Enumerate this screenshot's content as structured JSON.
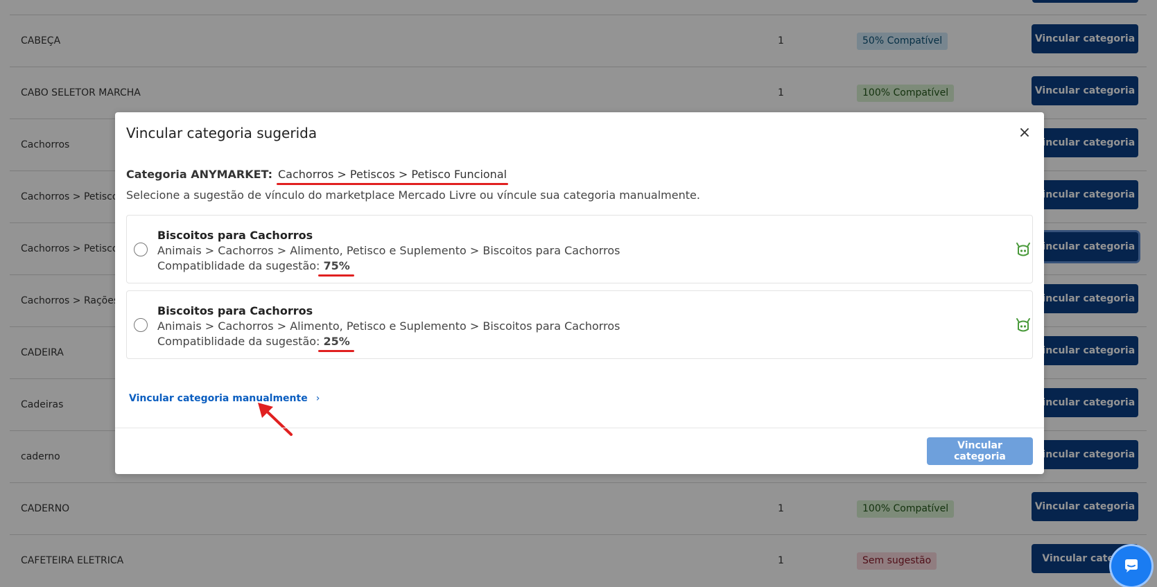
{
  "table": {
    "rows": [
      {
        "name": "CABEÇA",
        "count": "1",
        "badge": "50% Compatível",
        "badge_kind": "partial",
        "button": "Vincular categoria"
      },
      {
        "name": "CABO SELETOR MARCHA",
        "count": "1",
        "badge": "100% Compatível",
        "badge_kind": "full",
        "button": "Vincular categoria"
      },
      {
        "name": "Cachorros",
        "count": "",
        "badge": "",
        "badge_kind": "",
        "button": "Vincular categoria"
      },
      {
        "name": "Cachorros > Petiscos",
        "count": "",
        "badge": "",
        "badge_kind": "",
        "button": "Vincular categoria"
      },
      {
        "name": "Cachorros > Petiscos",
        "count": "",
        "badge": "",
        "badge_kind": "",
        "button": "Vincular categoria"
      },
      {
        "name": "Cachorros > Rações >",
        "count": "",
        "badge": "",
        "badge_kind": "",
        "button": "Vincular categoria"
      },
      {
        "name": "CADEIRA",
        "count": "",
        "badge": "",
        "badge_kind": "",
        "button": "Vincular categoria"
      },
      {
        "name": "Cadeiras",
        "count": "",
        "badge": "",
        "badge_kind": "",
        "button": "Vincular categoria"
      },
      {
        "name": "caderno",
        "count": "",
        "badge": "",
        "badge_kind": "",
        "button": "Vincular categoria"
      },
      {
        "name": "CADERNO",
        "count": "1",
        "badge": "100% Compatível",
        "badge_kind": "full",
        "button": "Vincular categoria"
      },
      {
        "name": "CAFETEIRA ELETRICA",
        "count": "1",
        "badge": "Sem sugestão",
        "badge_kind": "none",
        "button": "Vincular catego"
      }
    ]
  },
  "modal": {
    "title": "Vincular categoria sugerida",
    "close_label": "×",
    "category_label": "Categoria ANYMARKET:",
    "category_path": "Cachorros > Petiscos > Petisco Funcional",
    "instructions": "Selecione a sugestão de vínculo do marketplace Mercado Livre ou víncule sua categoria manualmente.",
    "suggestions": [
      {
        "title": "Biscoitos para Cachorros",
        "path": "Animais > Cachorros > Alimento, Petisco e Suplemento > Biscoitos para Cachorros",
        "compat_label": "Compatiblidade da sugestão:",
        "compat_value": "75%",
        "icon": "robot-icon"
      },
      {
        "title": "Biscoitos para Cachorros",
        "path": "Animais > Cachorros > Alimento, Petisco e Suplemento > Biscoitos para Cachorros",
        "compat_label": "Compatiblidade da sugestão:",
        "compat_value": "25%",
        "icon": "robot-icon"
      }
    ],
    "manual_link": "Vincular categoria manualmente",
    "manual_chevron": "›",
    "submit_label": "Vincular categoria"
  },
  "colors": {
    "primary_button": "#0b3f86",
    "disabled_button": "#6ea0dc",
    "link": "#0b5ec0",
    "annotation": "#e02020",
    "robot": "#4a9a3b",
    "chat_button": "#1a7cf2"
  }
}
